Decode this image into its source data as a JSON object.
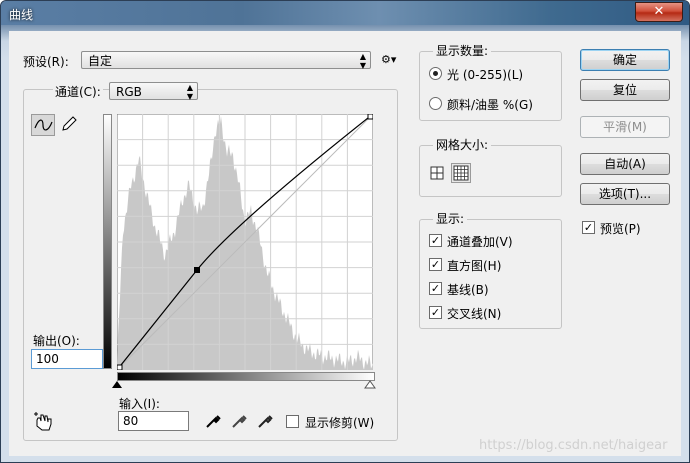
{
  "window": {
    "title": "曲线",
    "close_symbol": "✕"
  },
  "preset": {
    "label": "预设(R):",
    "value": "自定",
    "gear": "⚙▾"
  },
  "channel": {
    "label": "通道(C):",
    "value": "RGB"
  },
  "output": {
    "label": "输出(O):",
    "value": "100"
  },
  "input": {
    "label": "输入(I):",
    "value": "80"
  },
  "show_clipping": {
    "label": "显示修剪(W)",
    "checked": false
  },
  "buttons": {
    "ok": "确定",
    "reset": "复位",
    "smooth": "平滑(M)",
    "auto": "自动(A)",
    "options": "选项(T)...",
    "preview": "预览(P)"
  },
  "display_amount": {
    "legend": "显示数量:",
    "light": "光 (0-255)(L)",
    "pigment": "颜料/油墨 %(G)",
    "selected": "light"
  },
  "grid_size": {
    "legend": "网格大小:"
  },
  "display": {
    "legend": "显示:",
    "items": [
      "通道叠加(V)",
      "直方图(H)",
      "基线(B)",
      "交叉线(N)"
    ]
  },
  "watermark": "https://blog.csdn.net/haigear",
  "colors": {
    "title_text": "#ffffff",
    "dialog_bg": "#f0f0f0",
    "histogram": "#c8c8c8",
    "curve": "#000000"
  }
}
